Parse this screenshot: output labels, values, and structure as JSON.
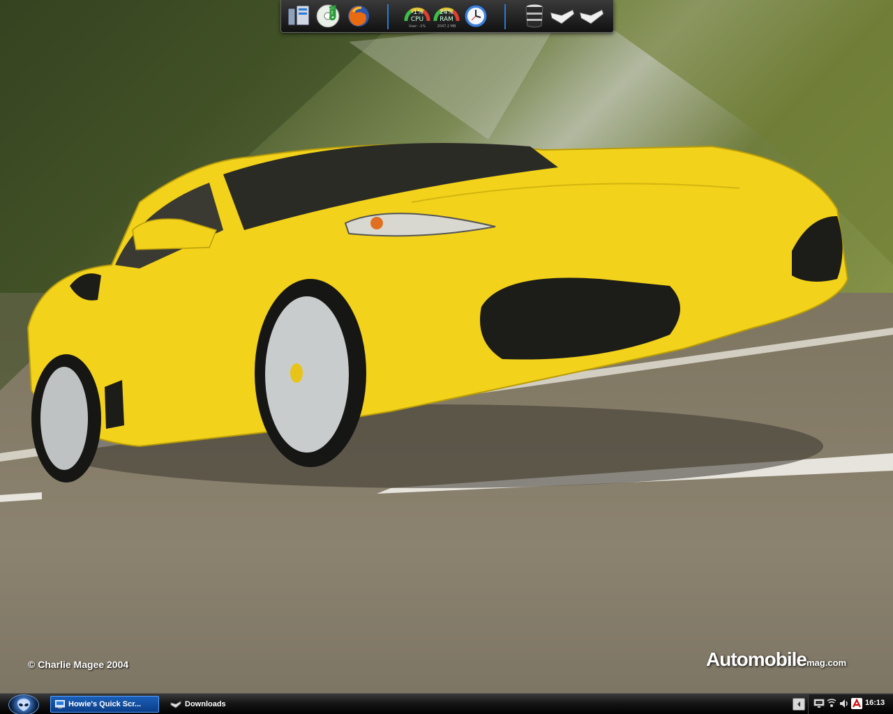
{
  "wallpaper": {
    "credit": "© Charlie Magee 2004",
    "brand_main": "Automobile",
    "brand_suffix": "mag.com",
    "car_color": "#f2d21a"
  },
  "dock": {
    "items": [
      {
        "name": "network-drives-icon"
      },
      {
        "name": "media-player-icon"
      },
      {
        "name": "firefox-icon"
      },
      {
        "name": "cpu-gauge"
      },
      {
        "name": "ram-gauge"
      },
      {
        "name": "clock-gadget-icon"
      },
      {
        "name": "recycle-bin-icon"
      },
      {
        "name": "folder-arrow-icon-1"
      },
      {
        "name": "folder-arrow-icon-2"
      }
    ],
    "cpu": {
      "percent": "-1%",
      "label": "CPU",
      "sub": "User: -1%",
      "value": -1
    },
    "ram": {
      "percent": "24%",
      "label": "RAM",
      "sub": "2047.2 MB",
      "value": 24
    },
    "accent": "#2a7bd8"
  },
  "taskbar": {
    "tasks": [
      {
        "label": "Howie's Quick Scr...",
        "active": true,
        "icon": "screenshot-app-icon"
      },
      {
        "label": "Downloads",
        "active": false,
        "icon": "folder-icon"
      }
    ],
    "tray_icons": [
      "show-hidden-icons-arrow",
      "monitor-icon",
      "network-icon",
      "sound-icon",
      "antivirus-icon"
    ],
    "clock": "16:13"
  }
}
